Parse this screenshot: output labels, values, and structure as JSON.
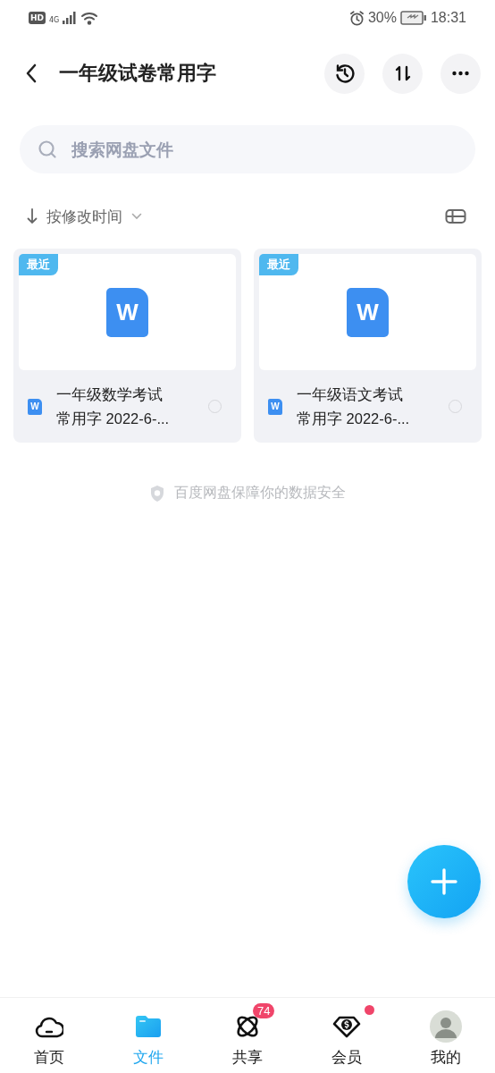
{
  "status_bar": {
    "hd": "HD",
    "network": "4G",
    "battery": "30%",
    "time": "18:31"
  },
  "header": {
    "title": "一年级试卷常用字"
  },
  "search": {
    "placeholder": "搜索网盘文件"
  },
  "sort": {
    "label": "按修改时间"
  },
  "files": [
    {
      "tag": "最近",
      "icon_letter": "W",
      "small_icon_letter": "W",
      "name": "一年级数学考试常用字 2022-6-...",
      "selected": false
    },
    {
      "tag": "最近",
      "icon_letter": "W",
      "small_icon_letter": "W",
      "name": "一年级语文考试常用字 2022-6-...",
      "selected": false
    }
  ],
  "footer_note": "百度网盘保障你的数据安全",
  "nav": [
    {
      "kind": "home",
      "label": "首页",
      "selected": false
    },
    {
      "kind": "files",
      "label": "文件",
      "selected": true
    },
    {
      "kind": "share",
      "label": "共享",
      "selected": false,
      "badge": "74"
    },
    {
      "kind": "vip",
      "label": "会员",
      "selected": false,
      "dot": true
    },
    {
      "kind": "me",
      "label": "我的",
      "selected": false
    }
  ]
}
